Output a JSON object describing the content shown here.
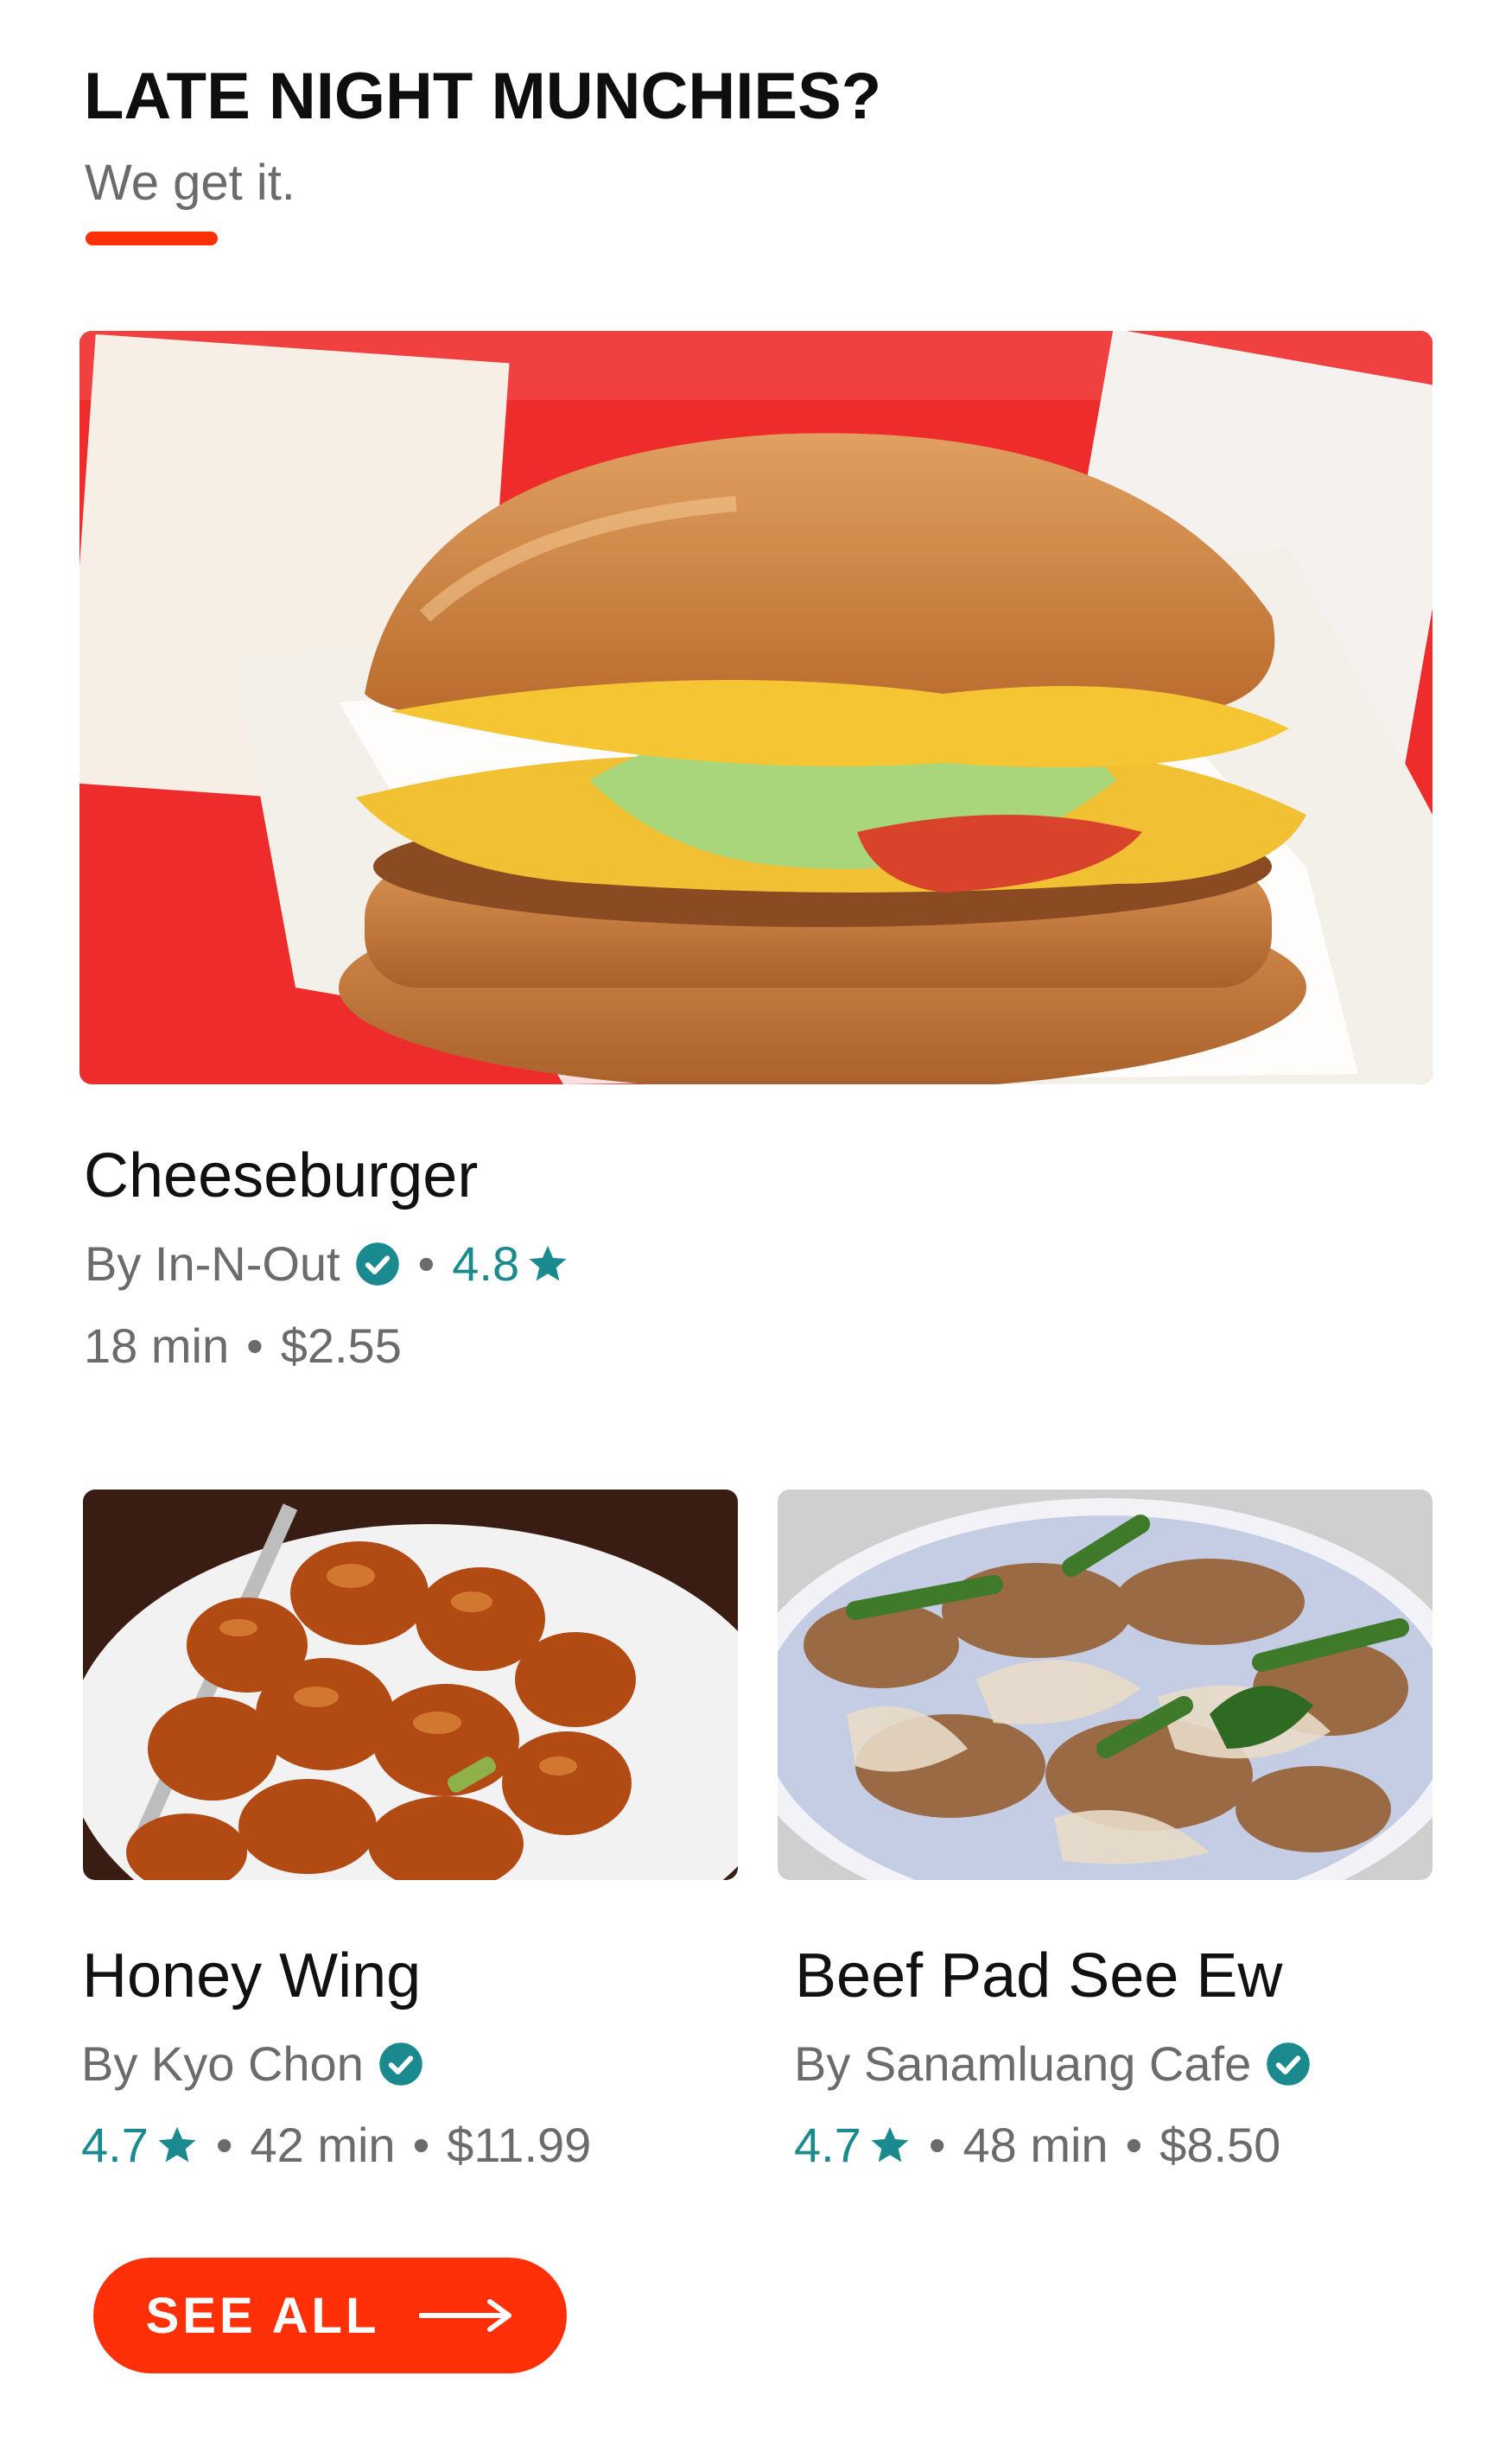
{
  "section": {
    "title": "LATE NIGHT MUNCHIES?",
    "subtitle": "We get it."
  },
  "featured": {
    "name": "Cheeseburger",
    "by": "By In-N-Out",
    "rating": "4.8",
    "time": "18 min",
    "price": "$2.55",
    "image_icon": "cheeseburger-photo"
  },
  "items": [
    {
      "name": "Honey Wing",
      "by": "By Kyo Chon",
      "rating": "4.7",
      "time": "42 min",
      "price": "$11.99",
      "image_icon": "honey-wing-photo"
    },
    {
      "name": "Beef Pad See Ew",
      "by": "By Sanamluang Cafe",
      "rating": "4.7",
      "time": "48 min",
      "price": "$8.50",
      "image_icon": "pad-see-ew-photo"
    }
  ],
  "cta": {
    "label": "SEE ALL"
  },
  "colors": {
    "accent": "#ff3008",
    "rating": "#1b8a8f",
    "muted": "#6b6b6b"
  }
}
